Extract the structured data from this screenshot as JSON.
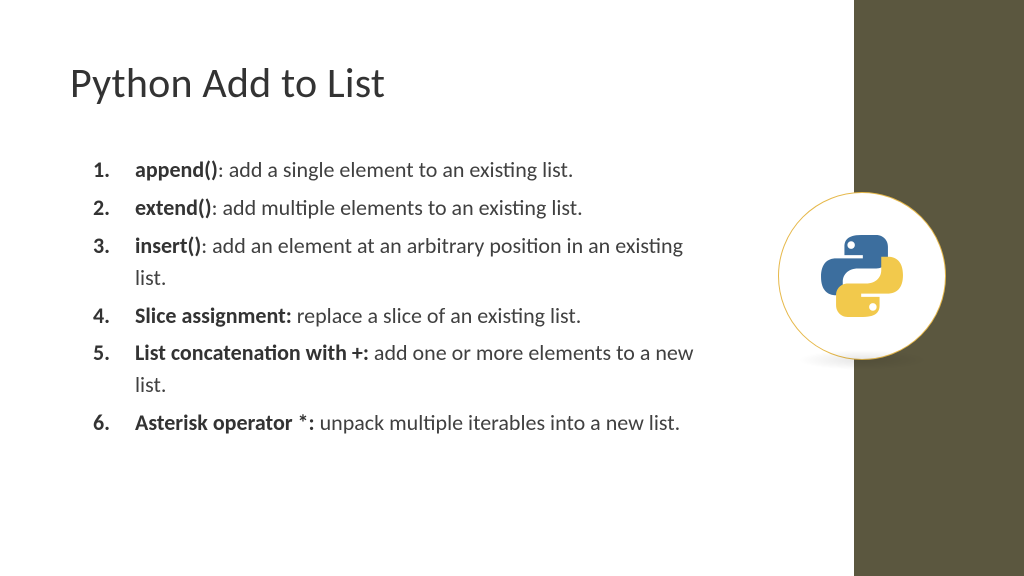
{
  "title": "Python Add to List",
  "items": [
    {
      "strong": "append()",
      "sep": ": ",
      "rest": "add a single element to an existing list."
    },
    {
      "strong": "extend()",
      "sep": ": ",
      "rest": "add multiple elements to an existing list."
    },
    {
      "strong": "insert()",
      "sep": ": ",
      "rest": "add an element at an arbitrary position in an existing list."
    },
    {
      "strong": "Slice assignment:",
      "sep": " ",
      "rest": "replace a slice of an existing list."
    },
    {
      "strong": "List concatenation with +:",
      "sep": " ",
      "rest": "add one or more elements to a new list."
    },
    {
      "strong": "Asterisk operator *:",
      "sep": " ",
      "rest": "unpack multiple iterables into a new list."
    }
  ],
  "logo": {
    "name": "python-logo"
  },
  "colors": {
    "sidebar": "#5b573f",
    "logo_blue": "#3c6e9e",
    "logo_yellow": "#f2c94c"
  }
}
